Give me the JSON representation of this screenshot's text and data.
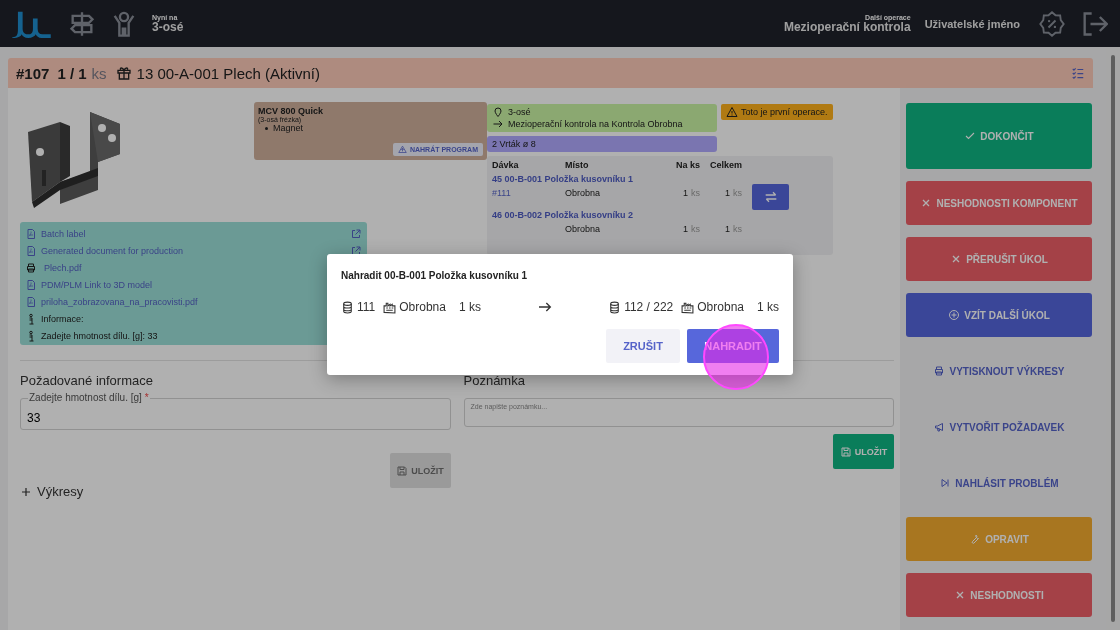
{
  "header": {
    "now_label": "Nyní na",
    "now_value": "3-osé",
    "next_label": "Další operace",
    "next_value": "Mezioperační kontrola",
    "user": "Uživatelské jméno"
  },
  "task": {
    "id": "#107",
    "quantity": "1 / 1",
    "unit": "ks",
    "title": "13 00-A-001 Plech (Aktivní)"
  },
  "machine": {
    "name": "MCV 800 Quick",
    "type": "(3-osá frézka)",
    "tools": [
      "Magnet"
    ],
    "button": "NAHRÁT PROGRAM"
  },
  "documents": [
    {
      "kind": "pdf",
      "label": "Batch label",
      "external": true
    },
    {
      "kind": "pdf",
      "label": "Generated document for production",
      "external": true
    },
    {
      "kind": "print",
      "label": "Plech.pdf",
      "external": false
    },
    {
      "kind": "pdf",
      "label": "PDM/PLM Link to 3D model",
      "external": false
    },
    {
      "kind": "pdf",
      "label": "priloha_zobrazovana_na_pracovisti.pdf",
      "external": false
    },
    {
      "kind": "info",
      "label": "Informace:",
      "external": false
    },
    {
      "kind": "info",
      "label": "Zadejte hmotnost dílu. [g]: 33",
      "external": false
    }
  ],
  "workplace": {
    "location": "3-osé",
    "route": "Mezioperační kontrola na Kontrola Obrobna"
  },
  "warning": "Toto je první operace.",
  "tool": "2 Vrták ø 8",
  "components": {
    "columns": [
      "Dávka",
      "Místo",
      "Na ks",
      "Celkem"
    ],
    "groups": [
      {
        "title": "45 00-B-001 Položka kusovníku 1",
        "rows": [
          {
            "batch": "#111",
            "place": "Obrobna",
            "per_piece": "1",
            "per_piece_unit": "ks",
            "total": "1",
            "total_unit": "ks",
            "swap": true
          }
        ]
      },
      {
        "title": "46 00-B-002 Položka kusovníku 2",
        "rows": [
          {
            "place": "Obrobna",
            "per_piece": "1",
            "per_piece_unit": "ks",
            "total": "1",
            "total_unit": "ks",
            "swap": false
          }
        ]
      }
    ]
  },
  "required_info": {
    "heading": "Požadované informace",
    "fields": [
      {
        "label": "Zadejte hmotnost dílu. [g]",
        "required_mark": "*",
        "value": "33"
      }
    ],
    "save_button": {
      "label": "ULOŽIT",
      "disabled": true
    }
  },
  "drawings": {
    "label": "Výkresy",
    "expanded": false
  },
  "note": {
    "heading": "Poznámka",
    "placeholder": "Zde napište poznámku...",
    "save_button": {
      "label": "ULOŽIT",
      "disabled": false
    }
  },
  "actions": [
    {
      "label": "DOKONČIT",
      "kind": "success"
    },
    {
      "label": "NESHODNOSTI KOMPONENT",
      "kind": "danger"
    },
    {
      "label": "PŘERUŠIT ÚKOL",
      "kind": "danger"
    },
    {
      "label": "VZÍT DALŠÍ ÚKOL",
      "kind": "primary"
    },
    {
      "label": "VYTISKNOUT VÝKRESY",
      "kind": "secondary"
    },
    {
      "label": "VYTVOŘIT POŽADAVEK",
      "kind": "secondary"
    },
    {
      "label": "NAHLÁSIT PROBLÉM",
      "kind": "secondary"
    },
    {
      "label": "OPRAVIT",
      "kind": "warning"
    },
    {
      "label": "NESHODNOSTI",
      "kind": "danger"
    }
  ],
  "dialog": {
    "title": "Nahradit 00-B-001 Položka kusovníku 1",
    "from": {
      "batch": "111",
      "place": "Obrobna",
      "quantity": "1 ks"
    },
    "to": {
      "batch": "112 / 222",
      "place": "Obrobna",
      "quantity": "1 ks"
    },
    "buttons": [
      {
        "label": "ZRUŠIT",
        "kind": "secondary"
      },
      {
        "label": "NAHRADIT",
        "kind": "primary"
      }
    ]
  }
}
